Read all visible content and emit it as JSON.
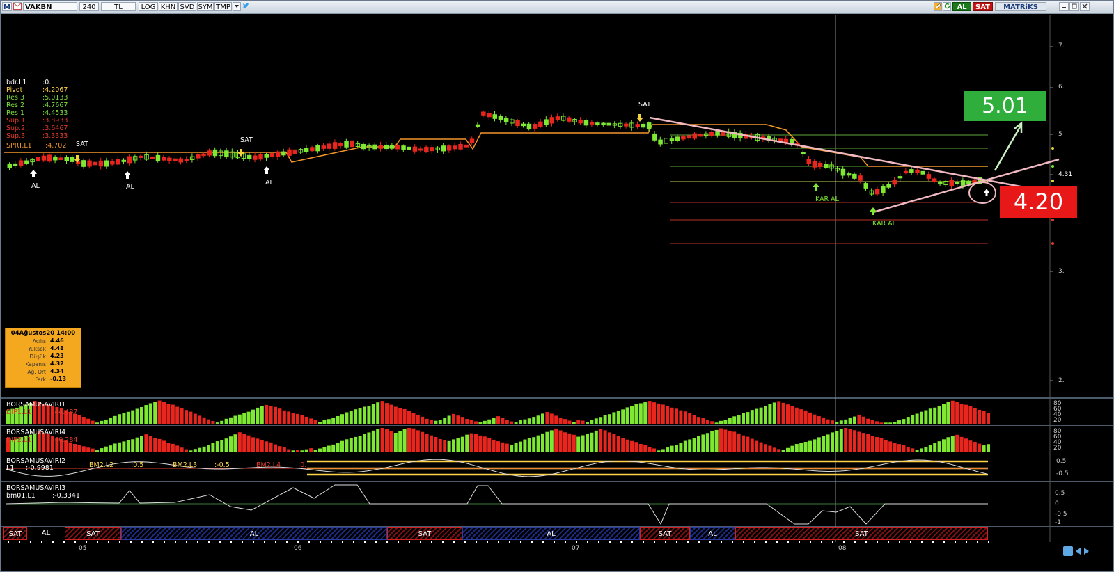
{
  "toolbar": {
    "m_label": "M",
    "symbol": "VAKBN",
    "period": "240",
    "currency": "TL",
    "log": "LOG",
    "khn": "KHN",
    "svd": "SVD",
    "sym": "SYM",
    "tmp": "TMP",
    "al": "AL",
    "sat": "SAT",
    "brand": "MATRiKS"
  },
  "pivot_labels": [
    {
      "name": "bdr.L1",
      "value": ":0.",
      "color": "#ffffff"
    },
    {
      "name": "Pivot",
      "value": ":4.2067",
      "color": "#ffd24a"
    },
    {
      "name": "Res.3",
      "value": ":5.0133",
      "color": "#7cdc3a"
    },
    {
      "name": "Res.2",
      "value": ":4.7667",
      "color": "#7cdc3a"
    },
    {
      "name": "Res.1",
      "value": ":4.4533",
      "color": "#7cdc3a"
    },
    {
      "name": "Sup.1",
      "value": ":3.8933",
      "color": "#e03a2a"
    },
    {
      "name": "Sup.2",
      "value": ":3.6467",
      "color": "#e03a2a"
    },
    {
      "name": "Sup.3",
      "value": ":3.3333",
      "color": "#e03a2a"
    },
    {
      "name": "SPRT.L1",
      "value": ":4.702",
      "color": "#f2962a"
    }
  ],
  "signals": {
    "sat": "SAT",
    "al": "AL",
    "kar_al": "KAR AL"
  },
  "price_axis": [
    "7.",
    "6.",
    "5",
    "4.31",
    "3.",
    "2."
  ],
  "info_box": {
    "title": "04Ağustos20 14:00",
    "rows": [
      {
        "k": "Açılış",
        "v": "4.46"
      },
      {
        "k": "Yüksek",
        "v": "4.48"
      },
      {
        "k": "Düşük",
        "v": "4.23"
      },
      {
        "k": "Kapanış",
        "v": "4.32"
      },
      {
        "k": "Ağ. Ort",
        "v": "4.34"
      },
      {
        "k": "Fark",
        "v": "-0.13"
      }
    ]
  },
  "annotations": {
    "target": "5.01",
    "support": "4.20"
  },
  "panels": {
    "p1": {
      "name": "BORSAMUSAVIRI1",
      "sub": "DIP1.L1",
      "subval": ":44.487",
      "ticks": [
        "80",
        "60",
        "40",
        "20"
      ]
    },
    "p2": {
      "name": "BORSAMUSAVIRI4",
      "sub": "DIP2.L1",
      "subval": ":40.284",
      "ticks": [
        "80",
        "60",
        "40",
        "20"
      ]
    },
    "p3": {
      "name": "BORSAMUSAVIRI2",
      "sub": "L1",
      "subval": ":-0.9981",
      "bm": [
        {
          "n": "BM2.L2",
          "v": ":0.5",
          "c": "#ffd24a"
        },
        {
          "n": "BM2.L3",
          "v": ":-0.5",
          "c": "#ffd24a"
        },
        {
          "n": "BM2.L4",
          "v": ":0.",
          "c": "#e03a2a"
        }
      ],
      "ticks": [
        "0.5",
        "-0.5"
      ]
    },
    "p4": {
      "name": "BORSAMUSAVIRI3",
      "sub": "bm01.L1",
      "subval": ":-0.3341",
      "ticks": [
        "0.5",
        "0",
        "-0.5",
        "-1"
      ]
    }
  },
  "status_bar": [
    {
      "label": "SAT",
      "kind": "sat"
    },
    {
      "label": "AL",
      "kind": "alplain"
    },
    {
      "label": "SAT",
      "kind": "sat"
    },
    {
      "label": "AL",
      "kind": "al"
    },
    {
      "label": "SAT",
      "kind": "sat"
    },
    {
      "label": "AL",
      "kind": "al"
    },
    {
      "label": "SAT",
      "kind": "sat"
    },
    {
      "label": "AL",
      "kind": "al"
    },
    {
      "label": "SAT",
      "kind": "sat"
    }
  ],
  "date_axis": [
    "05",
    "06",
    "07",
    "08"
  ],
  "colors": {
    "bull": "#7ee832",
    "bear": "#e8261e",
    "orange": "#f2962a",
    "trend": "#f0b8c0"
  }
}
